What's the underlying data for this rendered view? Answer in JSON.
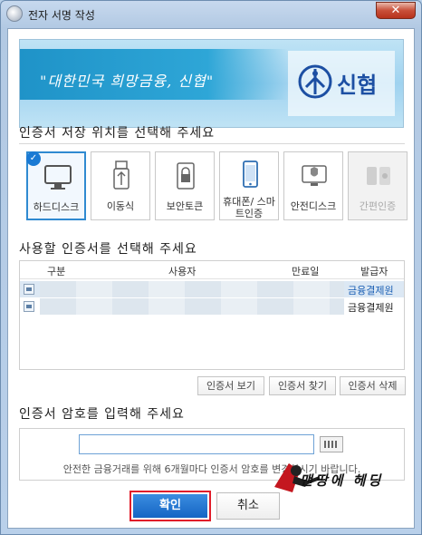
{
  "window": {
    "title": "전자 서명 작성",
    "close_label": "✕"
  },
  "banner": {
    "slogan": "\"대한민국 희망금융, 신협\"",
    "logo_text": "신협"
  },
  "storage": {
    "title": "인증서 저장 위치를 선택해 주세요",
    "options": [
      {
        "label": "하드디스크",
        "icon": "monitor-icon",
        "selected": true
      },
      {
        "label": "이동식",
        "icon": "usb-icon"
      },
      {
        "label": "보안토큰",
        "icon": "token-lock-icon"
      },
      {
        "label": "휴대폰/ 스마트인증",
        "icon": "smartphone-icon"
      },
      {
        "label": "안전디스크",
        "icon": "shield-monitor-icon"
      },
      {
        "label": "간편인증",
        "icon": "simple-auth-icon",
        "disabled": true
      }
    ]
  },
  "certs": {
    "title": "사용할 인증서를 선택해 주세요",
    "columns": [
      "구분",
      "사용자",
      "만료일",
      "발급자"
    ],
    "rows": [
      {
        "issuer": "금융결제원"
      },
      {
        "issuer": "금융결제원"
      }
    ],
    "buttons": {
      "view": "인증서 보기",
      "find": "인증서 찾기",
      "delete": "인증서 삭제"
    }
  },
  "password": {
    "title": "인증서 암호를 입력해 주세요",
    "value": "",
    "hint": "안전한 금융거래를 위해 6개월마다 인증서 암호를 변경하시기 바랍니다."
  },
  "actions": {
    "ok": "확인",
    "cancel": "취소"
  },
  "watermark": {
    "text": "맨땅에 헤딩"
  },
  "colors": {
    "accent": "#1565c4",
    "highlight_border": "#e11d2a",
    "issuer_link": "#1a5fb4"
  }
}
